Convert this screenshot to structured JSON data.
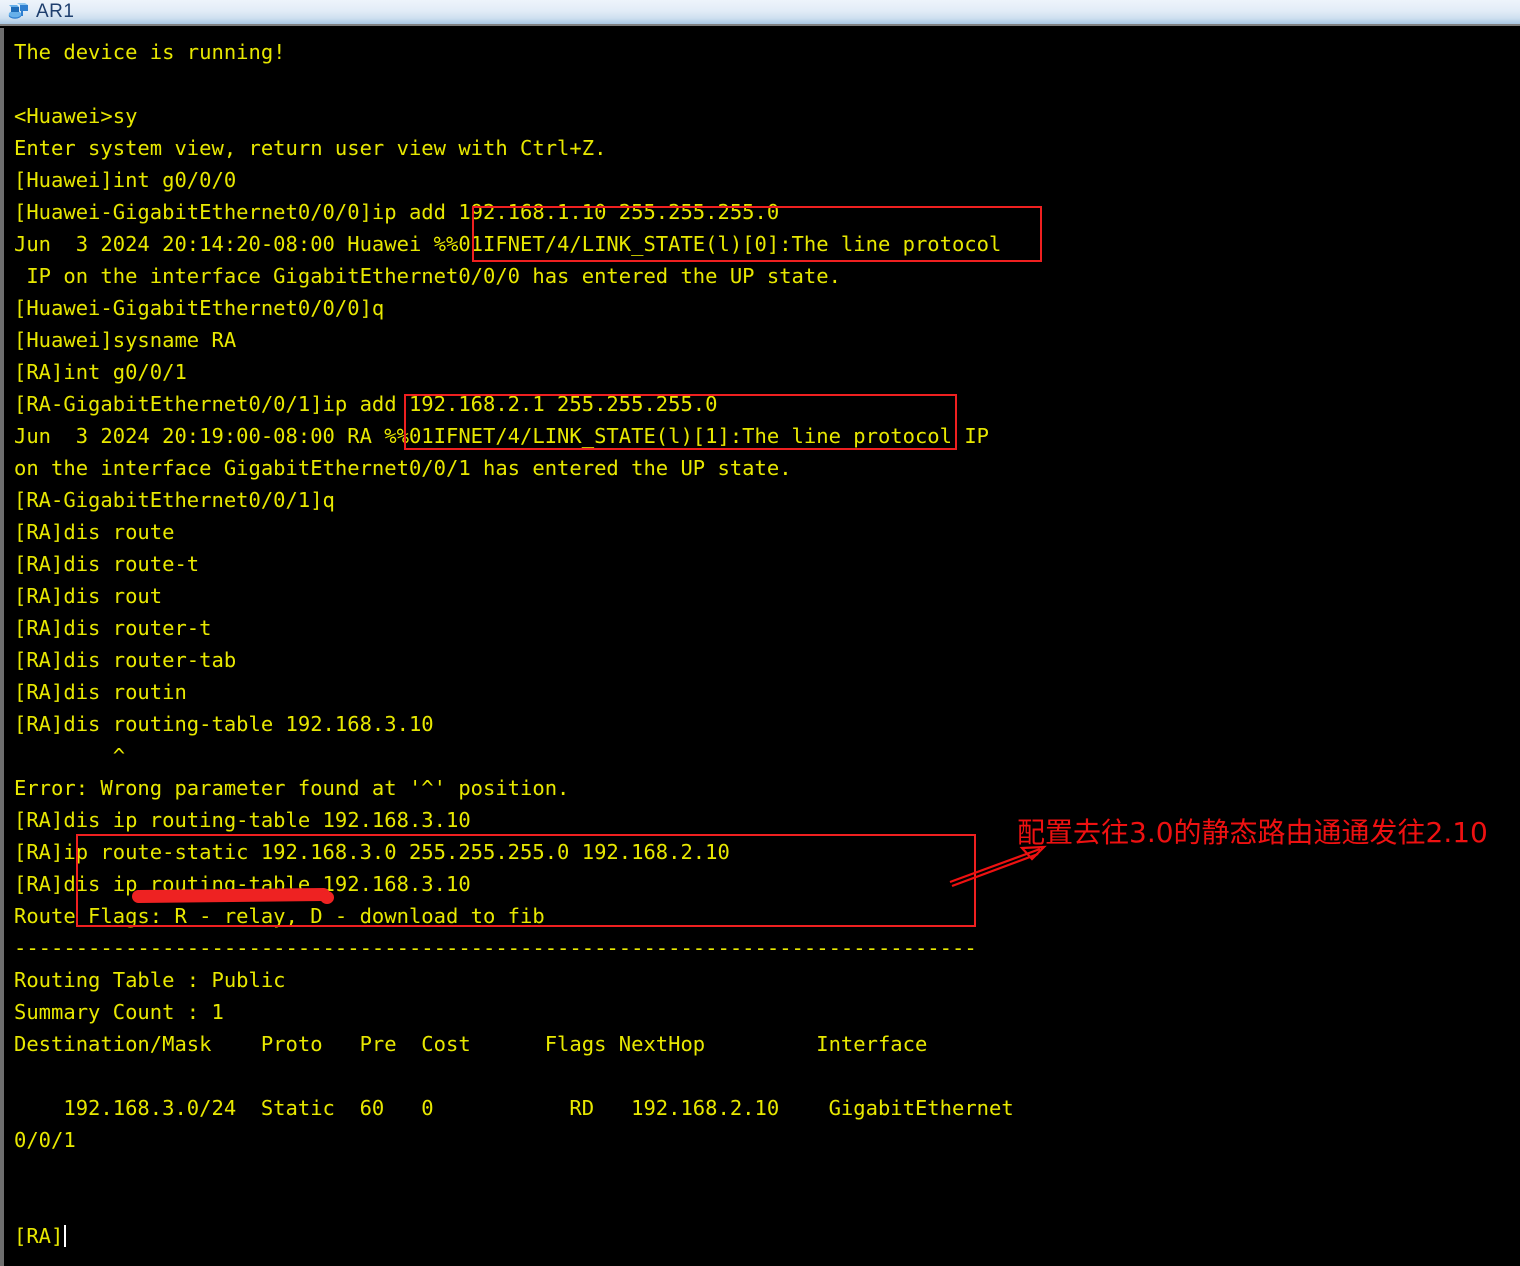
{
  "window": {
    "title": "AR1",
    "icon": "router-device-icon"
  },
  "colors": {
    "terminal_bg": "#000000",
    "terminal_fg": "#e8e800",
    "annotation_red": "#ee1111",
    "titlebar_text": "#1f3f6e",
    "cursor": "#ffffff"
  },
  "terminal": {
    "lines": [
      "The device is running!",
      "",
      "<Huawei>sy",
      "Enter system view, return user view with Ctrl+Z.",
      "[Huawei]int g0/0/0",
      "[Huawei-GigabitEthernet0/0/0]ip add 192.168.1.10 255.255.255.0",
      "Jun  3 2024 20:14:20-08:00 Huawei %%01IFNET/4/LINK_STATE(l)[0]:The line protocol",
      " IP on the interface GigabitEthernet0/0/0 has entered the UP state.",
      "[Huawei-GigabitEthernet0/0/0]q",
      "[Huawei]sysname RA",
      "[RA]int g0/0/1",
      "[RA-GigabitEthernet0/0/1]ip add 192.168.2.1 255.255.255.0",
      "Jun  3 2024 20:19:00-08:00 RA %%01IFNET/4/LINK_STATE(l)[1]:The line protocol IP",
      "on the interface GigabitEthernet0/0/1 has entered the UP state.",
      "[RA-GigabitEthernet0/0/1]q",
      "[RA]dis route",
      "[RA]dis route-t",
      "[RA]dis rout",
      "[RA]dis router-t",
      "[RA]dis router-tab",
      "[RA]dis routin",
      "[RA]dis routing-table 192.168.3.10",
      "        ^",
      "Error: Wrong parameter found at '^' position.",
      "[RA]dis ip routing-table 192.168.3.10",
      "[RA]ip route-static 192.168.3.0 255.255.255.0 192.168.2.10",
      "[RA]dis ip routing-table 192.168.3.10",
      "Route Flags: R - relay, D - download to fib",
      "------------------------------------------------------------------------------",
      "Routing Table : Public",
      "Summary Count : 1",
      "Destination/Mask    Proto   Pre  Cost      Flags NextHop         Interface",
      "",
      "    192.168.3.0/24  Static  60   0           RD   192.168.2.10    GigabitEthernet",
      "0/0/1",
      "",
      ""
    ],
    "prompt": "[RA]"
  },
  "routing_table": {
    "flags_legend": "Route Flags: R - relay, D - download to fib",
    "table_name": "Routing Table : Public",
    "summary_count": "Summary Count : 1",
    "headers": [
      "Destination/Mask",
      "Proto",
      "Pre",
      "Cost",
      "Flags",
      "NextHop",
      "Interface"
    ],
    "rows": [
      {
        "destination_mask": "192.168.3.0/24",
        "proto": "Static",
        "pre": "60",
        "cost": "0",
        "flags": "RD",
        "nexthop": "192.168.2.10",
        "interface": "GigabitEthernet0/0/1"
      }
    ]
  },
  "annotations": {
    "note_text": "配置去往3.0的静态路由通通发往2.10",
    "boxes": [
      {
        "name": "ip-add-g0-0-0",
        "content": "ip add 192.168.1.10 255.255.255.0"
      },
      {
        "name": "ip-add-g0-0-1",
        "content": "ip add 192.168.2.1 255.255.255.0"
      },
      {
        "name": "static-route-block",
        "content": "dis ip routing-table / ip route-static / dis ip routing-table"
      }
    ],
    "underline_target": "route-static"
  }
}
